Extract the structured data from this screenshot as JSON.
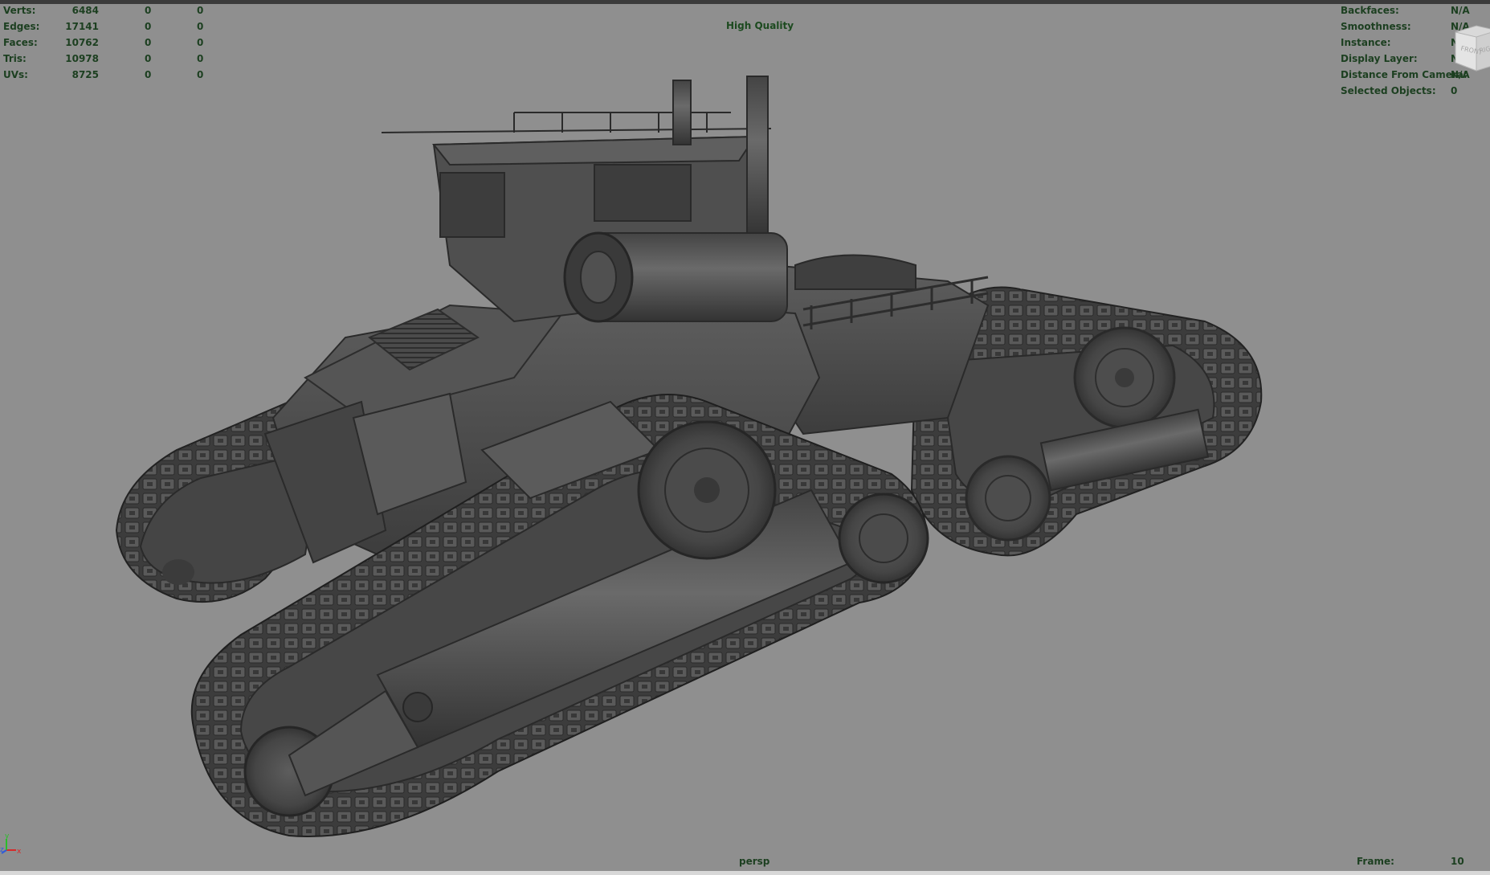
{
  "stats": [
    {
      "label": "Verts:",
      "total": "6484",
      "selected": "0",
      "component": "0"
    },
    {
      "label": "Edges:",
      "total": "17141",
      "selected": "0",
      "component": "0"
    },
    {
      "label": "Faces:",
      "total": "10762",
      "selected": "0",
      "component": "0"
    },
    {
      "label": "Tris:",
      "total": "10978",
      "selected": "0",
      "component": "0"
    },
    {
      "label": "UVs:",
      "total": "8725",
      "selected": "0",
      "component": "0"
    }
  ],
  "info": [
    {
      "label": "Backfaces:",
      "value": "N/A"
    },
    {
      "label": "Smoothness:",
      "value": "N/A"
    },
    {
      "label": "Instance:",
      "value": "N/A"
    },
    {
      "label": "Display Layer:",
      "value": "N/A"
    },
    {
      "label": "Distance From Camera:",
      "value": "N/A"
    },
    {
      "label": "Selected Objects:",
      "value": "0"
    }
  ],
  "quality": "High Quality",
  "camera": "persp",
  "frame": {
    "label": "Frame:",
    "value": "10"
  },
  "viewcube": {
    "front": "FRONT",
    "right": "RIGHT"
  },
  "axes": {
    "x": "x",
    "y": "y",
    "z": "z"
  },
  "colors": {
    "hud_text": "#1c3f20",
    "background": "#8f8f8f",
    "model": "#4a4a4a"
  }
}
